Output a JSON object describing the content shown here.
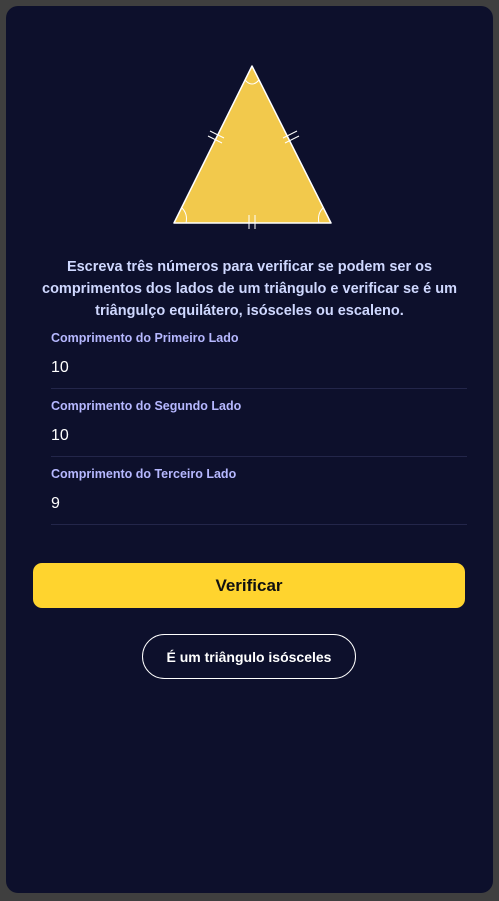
{
  "description": "Escreva três números para verificar se podem ser os comprimentos dos lados de um triângulo e verificar se é um triângulço equilátero, isósceles ou escaleno.",
  "fields": [
    {
      "label": "Comprimento do Primeiro Lado",
      "value": "10"
    },
    {
      "label": "Comprimento do Segundo Lado",
      "value": "10"
    },
    {
      "label": "Comprimento do Terceiro Lado",
      "value": "9"
    }
  ],
  "verify_button": {
    "label": "Verificar"
  },
  "result": {
    "text": "É um triângulo isósceles"
  },
  "colors": {
    "background": "#0d102c",
    "accent": "#ffd42e",
    "triangle_fill": "#f2c94c",
    "label": "#b6b8ff",
    "description": "#cfd8ff"
  },
  "icons": {
    "illustration": "triangle-illustration-icon"
  }
}
